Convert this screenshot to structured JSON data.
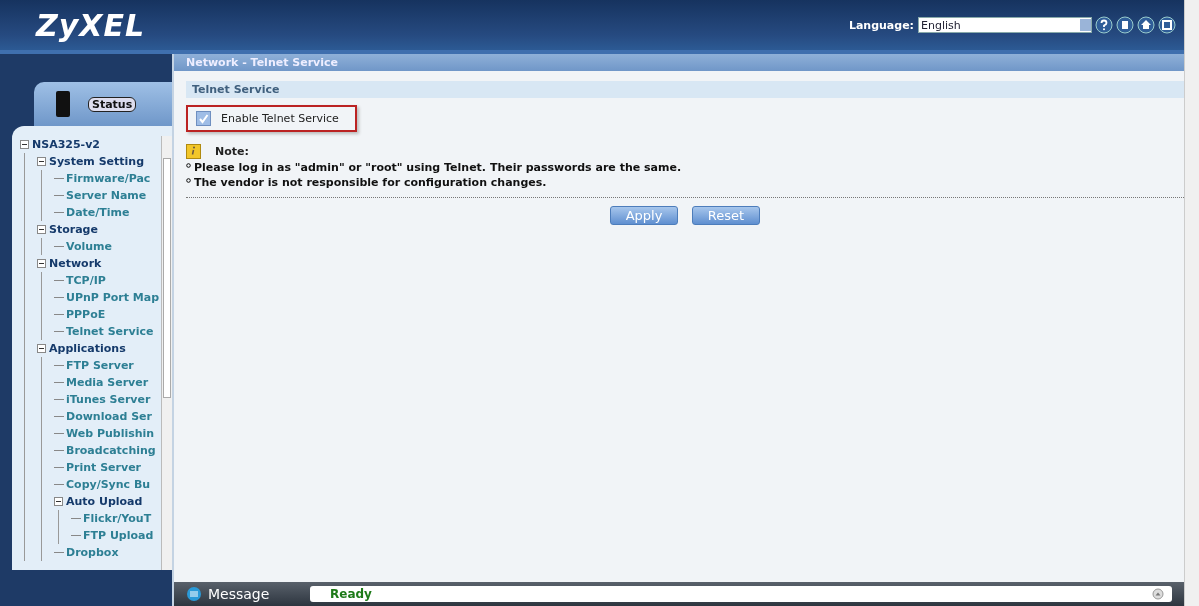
{
  "header": {
    "logo": "ZyXEL",
    "language_label": "Language:",
    "language_value": "English"
  },
  "sidebar": {
    "status_tab": "Status",
    "tree": [
      {
        "label": "NSA325-v2",
        "expanded": true,
        "children": [
          {
            "label": "System Setting",
            "expanded": true,
            "children": [
              {
                "label": "Firmware/Pac"
              },
              {
                "label": "Server Name"
              },
              {
                "label": "Date/Time"
              }
            ]
          },
          {
            "label": "Storage",
            "expanded": true,
            "children": [
              {
                "label": "Volume"
              }
            ]
          },
          {
            "label": "Network",
            "expanded": true,
            "children": [
              {
                "label": "TCP/IP"
              },
              {
                "label": "UPnP Port Map"
              },
              {
                "label": "PPPoE"
              },
              {
                "label": "Telnet Service"
              }
            ]
          },
          {
            "label": "Applications",
            "expanded": true,
            "children": [
              {
                "label": "FTP Server"
              },
              {
                "label": "Media Server"
              },
              {
                "label": "iTunes Server"
              },
              {
                "label": "Download Ser"
              },
              {
                "label": "Web Publishin"
              },
              {
                "label": "Broadcatching"
              },
              {
                "label": "Print Server"
              },
              {
                "label": "Copy/Sync Bu"
              },
              {
                "label": "Auto Upload",
                "expanded": true,
                "children": [
                  {
                    "label": "Flickr/YouT"
                  },
                  {
                    "label": "FTP Upload"
                  }
                ]
              },
              {
                "label": "Dropbox"
              }
            ]
          }
        ]
      }
    ]
  },
  "content": {
    "breadcrumb": "Network - Telnet Service",
    "section_title": "Telnet Service",
    "enable": {
      "label": "Enable Telnet Service",
      "checked": true
    },
    "note_title": "Note:",
    "notes": [
      "Please log in as \"admin\" or \"root\" using Telnet. Their passwords are the same.",
      "The vendor is not responsible for configuration changes."
    ],
    "buttons": [
      "Apply",
      "Reset"
    ]
  },
  "message_bar": {
    "label": "Message",
    "status": "Ready"
  }
}
